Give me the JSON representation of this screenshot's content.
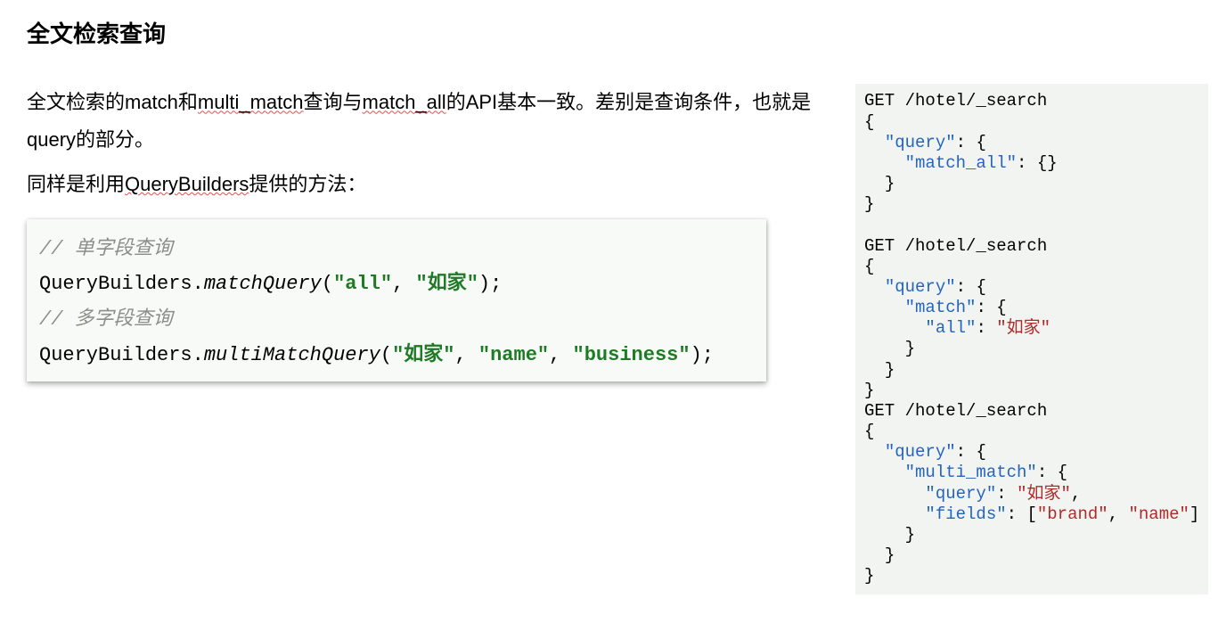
{
  "title": "全文检索查询",
  "paragraphs": {
    "p1_a": "全文检索的match和",
    "p1_b": "multi_match",
    "p1_c": "查询与",
    "p1_d": "match_all",
    "p1_e": "的API基本一致。差别是查询条件，也就是query的部分。",
    "p2_a": "同样是利用",
    "p2_b": "QueryBuilders",
    "p2_c": "提供的方法："
  },
  "java": {
    "comment1": "// 单字段查询",
    "line1_a": "QueryBuilders.",
    "line1_b": "matchQuery",
    "line1_c": "(",
    "line1_d": "\"all\"",
    "line1_e": ", ",
    "line1_f": "\"如家\"",
    "line1_g": ");",
    "comment2": "// 多字段查询",
    "line2_a": "QueryBuilders.",
    "line2_b": "multiMatchQuery",
    "line2_c": "(",
    "line2_d": "\"如家\"",
    "line2_e": ", ",
    "line2_f": "\"name\"",
    "line2_g": ", ",
    "line2_h": "\"business\"",
    "line2_i": ");"
  },
  "json_block": {
    "req1": "GET /hotel/_search",
    "obj_open": "{",
    "obj_close": "}",
    "arr_open": "[",
    "arr_close": "]",
    "comma": ",",
    "colon": ": ",
    "k_query": "\"query\"",
    "k_match_all": "\"match_all\"",
    "k_match": "\"match\"",
    "k_all": "\"all\"",
    "k_multi_match": "\"multi_match\"",
    "k_fields": "\"fields\"",
    "v_rujia": "\"如家\"",
    "v_brand": "\"brand\"",
    "v_name": "\"name\"",
    "empty_obj": "{}",
    "i1": "  ",
    "i2": "    ",
    "i3": "      ",
    "blank": ""
  }
}
